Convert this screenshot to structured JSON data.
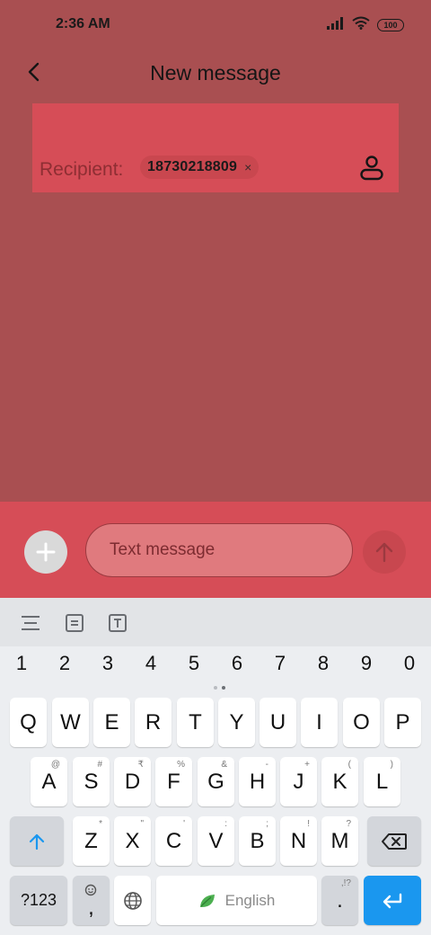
{
  "status_bar": {
    "time": "2:36 AM",
    "battery": "100"
  },
  "header": {
    "title": "New message"
  },
  "recipient": {
    "label": "Recipient:",
    "chip_number": "18730218809",
    "chip_remove": "×"
  },
  "compose": {
    "placeholder": "Text message"
  },
  "keyboard": {
    "numbers": [
      "1",
      "2",
      "3",
      "4",
      "5",
      "6",
      "7",
      "8",
      "9",
      "0"
    ],
    "row1": [
      "Q",
      "W",
      "E",
      "R",
      "T",
      "Y",
      "U",
      "I",
      "O",
      "P"
    ],
    "row2": [
      "A",
      "S",
      "D",
      "F",
      "G",
      "H",
      "J",
      "K",
      "L"
    ],
    "row2_hints": [
      "@",
      "#",
      "₹",
      "%",
      "&",
      "-",
      "+",
      "(",
      ")"
    ],
    "row3": [
      "Z",
      "X",
      "C",
      "V",
      "B",
      "N",
      "M"
    ],
    "row3_hints": [
      "*",
      "\"",
      "'",
      ":",
      ";",
      "!",
      "?"
    ],
    "symbols_key": "?123",
    "comma_key": ",",
    "period_key": ".",
    "period_hint": ",!?",
    "space_label": "English"
  },
  "colors": {
    "accent": "#1a97ef",
    "highlight": "#d64d57",
    "overlay": "#a94f51"
  }
}
